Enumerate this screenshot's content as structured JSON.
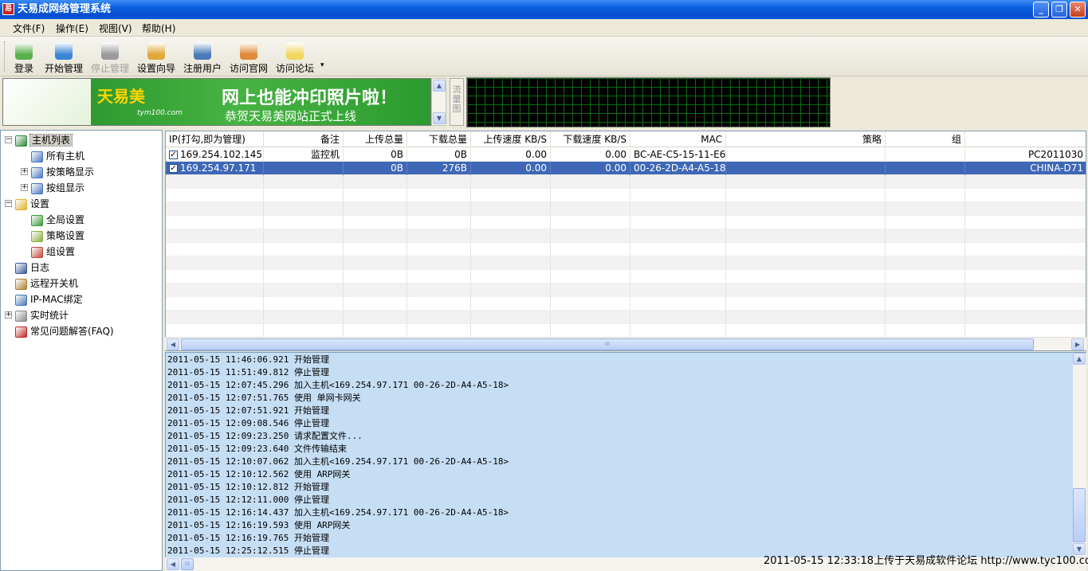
{
  "window": {
    "title": "天易成网络管理系统",
    "icon_char": "易",
    "minimize": "_",
    "restore": "❐",
    "close": "✕"
  },
  "menu": [
    "文件(F)",
    "操作(E)",
    "视图(V)",
    "帮助(H)"
  ],
  "toolbar": [
    {
      "label": "登录",
      "icon": "login-icon",
      "color": "#5ab04a",
      "enabled": true
    },
    {
      "label": "开始管理",
      "icon": "check-icon",
      "color": "#3a86d4",
      "enabled": true
    },
    {
      "label": "停止管理",
      "icon": "stop-icon",
      "color": "#9a9a9a",
      "enabled": false
    },
    {
      "label": "设置向导",
      "icon": "wizard-icon",
      "color": "#e0a83a",
      "enabled": true
    },
    {
      "label": "注册用户",
      "icon": "user-icon",
      "color": "#4a7ab8",
      "enabled": true
    },
    {
      "label": "访问官网",
      "icon": "home-icon",
      "color": "#e08a3a",
      "enabled": true
    },
    {
      "label": "访问论坛",
      "icon": "forum-icon",
      "color": "#f2d660",
      "enabled": true
    }
  ],
  "toolbar_more": "▾",
  "banner": {
    "logo": "天易美",
    "sub": "tym100.com",
    "headline": "网上也能冲印照片啦！",
    "line": "恭贺天易美网站正式上线"
  },
  "flow_label": "流量图",
  "tree": [
    {
      "label": "主机列表",
      "level": 0,
      "icon": "computer-list-icon",
      "expander": "−",
      "selected": true
    },
    {
      "label": "所有主机",
      "level": 1,
      "icon": "monitor-icon",
      "expander": ""
    },
    {
      "label": "按策略显示",
      "level": 1,
      "icon": "monitor-icon",
      "expander": "+"
    },
    {
      "label": "按组显示",
      "level": 1,
      "icon": "group-icon",
      "expander": "+"
    },
    {
      "label": "设置",
      "level": 0,
      "icon": "settings-icon",
      "expander": "−"
    },
    {
      "label": "全局设置",
      "level": 1,
      "icon": "global-icon",
      "expander": ""
    },
    {
      "label": "策略设置",
      "level": 1,
      "icon": "policy-icon",
      "expander": ""
    },
    {
      "label": "组设置",
      "level": 1,
      "icon": "group-settings-icon",
      "expander": ""
    },
    {
      "label": "日志",
      "level": 0,
      "icon": "log-icon",
      "expander": ""
    },
    {
      "label": "远程开关机",
      "level": 0,
      "icon": "remote-power-icon",
      "expander": ""
    },
    {
      "label": "IP-MAC绑定",
      "level": 0,
      "icon": "ip-mac-icon",
      "expander": ""
    },
    {
      "label": "实时统计",
      "level": 0,
      "icon": "stats-icon",
      "expander": "+"
    },
    {
      "label": "常见问题解答(FAQ)",
      "level": 0,
      "icon": "faq-icon",
      "expander": ""
    }
  ],
  "grid": {
    "headers": [
      "IP(打勾,即为管理)",
      "备注",
      "上传总量",
      "下载总量",
      "上传速度 KB/S",
      "下载速度 KB/S",
      "MAC",
      "策略",
      "组",
      ""
    ],
    "rows": [
      {
        "checked": true,
        "cells": [
          "169.254.102.145",
          "监控机",
          "0B",
          "0B",
          "0.00",
          "0.00",
          "BC-AE-C5-15-11-E6",
          "",
          "",
          "PC2011030"
        ]
      },
      {
        "checked": true,
        "selected": true,
        "cells": [
          "169.254.97.171",
          "",
          "0B",
          "276B",
          "0.00",
          "0.00",
          "00-26-2D-A4-A5-18",
          "",
          "",
          "CHINA-D71"
        ]
      }
    ],
    "check_mark": "✓",
    "empty_rows": 12
  },
  "scroll": {
    "left": "◀",
    "right": "▶",
    "up": "▲",
    "down": "▼",
    "grip": "III"
  },
  "log": [
    "2011-05-15 11:46:06.921 开始管理",
    "2011-05-15 11:51:49.812 停止管理",
    "2011-05-15 12:07:45.296 加入主机<169.254.97.171 00-26-2D-A4-A5-18>",
    "2011-05-15 12:07:51.765 使用 单网卡网关",
    "2011-05-15 12:07:51.921 开始管理",
    "2011-05-15 12:09:08.546 停止管理",
    "2011-05-15 12:09:23.250 请求配置文件...",
    "2011-05-15 12:09:23.640 文件传输结束",
    "2011-05-15 12:10:07.062 加入主机<169.254.97.171 00-26-2D-A4-A5-18>",
    "2011-05-15 12:10:12.562 使用 ARP网关",
    "2011-05-15 12:10:12.812 开始管理",
    "2011-05-15 12:12:11.000 停止管理",
    "2011-05-15 12:16:14.437 加入主机<169.254.97.171 00-26-2D-A4-A5-18>",
    "2011-05-15 12:16:19.593 使用 ARP网关",
    "2011-05-15 12:16:19.765 开始管理",
    "2011-05-15 12:25:12.515 停止管理"
  ],
  "watermark": "2011-05-15 12:33:18上传于天易成软件论坛 http://www.tyc100.com"
}
